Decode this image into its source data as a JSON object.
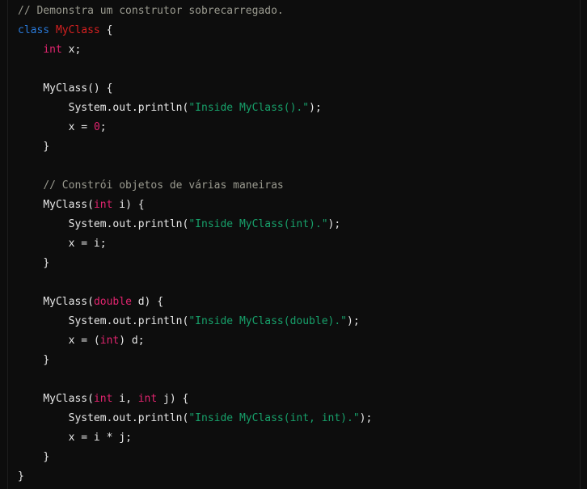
{
  "editor": {
    "name": "java-code-snippet",
    "language": "Java",
    "background_color": "#0d0d0d",
    "default_text_color": "#e8e8e8",
    "font_size_px": 13,
    "line_height_px": 24,
    "indent_spaces": 4
  },
  "theme": {
    "comment_color": "#9a9a8f",
    "keyword_color": "#2979d8",
    "type_color": "#e0246e",
    "class_name_color": "#d42020",
    "string_color": "#17a06a",
    "number_color": "#e0246e",
    "plain_color": "#e8e8e8",
    "edge_stripe_color": "#1e1e1e"
  },
  "code": {
    "plain_text": "// Demonstra um construtor sobrecarregado.\nclass MyClass {\n    int x;\n\n    MyClass() {\n        System.out.println(\"Inside MyClass().\");\n        x = 0;\n    }\n\n    // Constrói objetos de várias maneiras\n    MyClass(int i) {\n        System.out.println(\"Inside MyClass(int).\");\n        x = i;\n    }\n\n    MyClass(double d) {\n        System.out.println(\"Inside MyClass(double).\");\n        x = (int) d;\n    }\n\n    MyClass(int i, int j) {\n        System.out.println(\"Inside MyClass(int, int).\");\n        x = i * j;\n    }\n}",
    "lines": [
      {
        "indent": 0,
        "tokens": [
          {
            "t": "comment",
            "v": "// Demonstra um construtor sobrecarregado."
          }
        ]
      },
      {
        "indent": 0,
        "tokens": [
          {
            "t": "keyword",
            "v": "class"
          },
          {
            "t": "plain",
            "v": " "
          },
          {
            "t": "class",
            "v": "MyClass"
          },
          {
            "t": "plain",
            "v": " {"
          }
        ]
      },
      {
        "indent": 1,
        "tokens": [
          {
            "t": "type",
            "v": "int"
          },
          {
            "t": "plain",
            "v": " x;"
          }
        ]
      },
      {
        "indent": 0,
        "tokens": []
      },
      {
        "indent": 1,
        "tokens": [
          {
            "t": "plain",
            "v": "MyClass() {"
          }
        ]
      },
      {
        "indent": 2,
        "tokens": [
          {
            "t": "plain",
            "v": "System.out.println("
          },
          {
            "t": "string",
            "v": "\"Inside MyClass().\""
          },
          {
            "t": "plain",
            "v": ");"
          }
        ]
      },
      {
        "indent": 2,
        "tokens": [
          {
            "t": "plain",
            "v": "x = "
          },
          {
            "t": "number",
            "v": "0"
          },
          {
            "t": "plain",
            "v": ";"
          }
        ]
      },
      {
        "indent": 1,
        "tokens": [
          {
            "t": "plain",
            "v": "}"
          }
        ]
      },
      {
        "indent": 0,
        "tokens": []
      },
      {
        "indent": 1,
        "tokens": [
          {
            "t": "comment",
            "v": "// Constrói objetos de várias maneiras"
          }
        ]
      },
      {
        "indent": 1,
        "tokens": [
          {
            "t": "plain",
            "v": "MyClass("
          },
          {
            "t": "type",
            "v": "int"
          },
          {
            "t": "plain",
            "v": " i) {"
          }
        ]
      },
      {
        "indent": 2,
        "tokens": [
          {
            "t": "plain",
            "v": "System.out.println("
          },
          {
            "t": "string",
            "v": "\"Inside MyClass(int).\""
          },
          {
            "t": "plain",
            "v": ");"
          }
        ]
      },
      {
        "indent": 2,
        "tokens": [
          {
            "t": "plain",
            "v": "x = i;"
          }
        ]
      },
      {
        "indent": 1,
        "tokens": [
          {
            "t": "plain",
            "v": "}"
          }
        ]
      },
      {
        "indent": 0,
        "tokens": []
      },
      {
        "indent": 1,
        "tokens": [
          {
            "t": "plain",
            "v": "MyClass("
          },
          {
            "t": "type",
            "v": "double"
          },
          {
            "t": "plain",
            "v": " d) {"
          }
        ]
      },
      {
        "indent": 2,
        "tokens": [
          {
            "t": "plain",
            "v": "System.out.println("
          },
          {
            "t": "string",
            "v": "\"Inside MyClass(double).\""
          },
          {
            "t": "plain",
            "v": ");"
          }
        ]
      },
      {
        "indent": 2,
        "tokens": [
          {
            "t": "plain",
            "v": "x = ("
          },
          {
            "t": "type",
            "v": "int"
          },
          {
            "t": "plain",
            "v": ") d;"
          }
        ]
      },
      {
        "indent": 1,
        "tokens": [
          {
            "t": "plain",
            "v": "}"
          }
        ]
      },
      {
        "indent": 0,
        "tokens": []
      },
      {
        "indent": 1,
        "tokens": [
          {
            "t": "plain",
            "v": "MyClass("
          },
          {
            "t": "type",
            "v": "int"
          },
          {
            "t": "plain",
            "v": " i, "
          },
          {
            "t": "type",
            "v": "int"
          },
          {
            "t": "plain",
            "v": " j) {"
          }
        ]
      },
      {
        "indent": 2,
        "tokens": [
          {
            "t": "plain",
            "v": "System.out.println("
          },
          {
            "t": "string",
            "v": "\"Inside MyClass(int, int).\""
          },
          {
            "t": "plain",
            "v": ");"
          }
        ]
      },
      {
        "indent": 2,
        "tokens": [
          {
            "t": "plain",
            "v": "x = i * j;"
          }
        ]
      },
      {
        "indent": 1,
        "tokens": [
          {
            "t": "plain",
            "v": "}"
          }
        ]
      },
      {
        "indent": 0,
        "tokens": [
          {
            "t": "plain",
            "v": "}"
          }
        ]
      }
    ]
  }
}
